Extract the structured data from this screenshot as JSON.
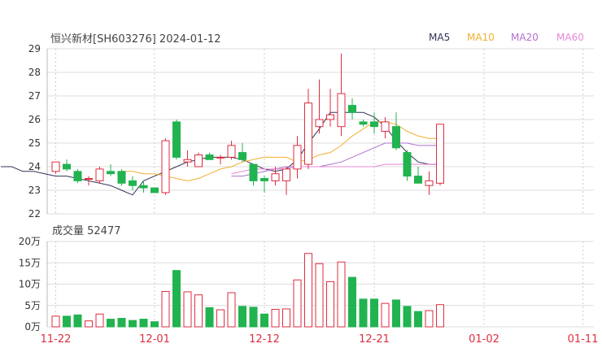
{
  "title": "恒兴新材[SH603276] 2024-01-12",
  "chart_data": [
    {
      "type": "candlestick",
      "ylim": [
        22,
        29
      ],
      "yticks": [
        22,
        23,
        24,
        25,
        26,
        27,
        28,
        29
      ],
      "x_tick_labels": [
        {
          "index": 0,
          "label": "11-22"
        },
        {
          "index": 9,
          "label": "12-01"
        },
        {
          "index": 19,
          "label": "12-12"
        },
        {
          "index": 29,
          "label": "12-21"
        },
        {
          "index": 39,
          "label": "01-02"
        },
        {
          "index": 48,
          "label": "01-11"
        }
      ],
      "legend": [
        {
          "name": "MA5",
          "color": "#333355"
        },
        {
          "name": "MA10",
          "color": "#f0b030"
        },
        {
          "name": "MA20",
          "color": "#b070d0"
        },
        {
          "name": "MA60",
          "color": "#e888d8"
        }
      ],
      "candles": [
        {
          "o": 23.8,
          "h": 24.2,
          "l": 23.7,
          "c": 24.2
        },
        {
          "o": 24.1,
          "h": 24.3,
          "l": 23.8,
          "c": 23.9
        },
        {
          "o": 23.8,
          "h": 23.9,
          "l": 23.3,
          "c": 23.4
        },
        {
          "o": 23.5,
          "h": 23.6,
          "l": 23.2,
          "c": 23.5
        },
        {
          "o": 23.4,
          "h": 24.0,
          "l": 23.3,
          "c": 23.9
        },
        {
          "o": 23.8,
          "h": 24.1,
          "l": 23.6,
          "c": 23.7
        },
        {
          "o": 23.8,
          "h": 23.9,
          "l": 23.2,
          "c": 23.3
        },
        {
          "o": 23.4,
          "h": 23.6,
          "l": 23.0,
          "c": 23.2
        },
        {
          "o": 23.2,
          "h": 23.4,
          "l": 22.9,
          "c": 23.1
        },
        {
          "o": 23.1,
          "h": 23.1,
          "l": 22.9,
          "c": 22.9
        },
        {
          "o": 22.9,
          "h": 25.2,
          "l": 22.8,
          "c": 25.1
        },
        {
          "o": 25.9,
          "h": 26.0,
          "l": 24.3,
          "c": 24.4
        },
        {
          "o": 24.2,
          "h": 24.7,
          "l": 24.0,
          "c": 24.3
        },
        {
          "o": 24.0,
          "h": 24.6,
          "l": 24.0,
          "c": 24.5
        },
        {
          "o": 24.5,
          "h": 24.6,
          "l": 24.3,
          "c": 24.3
        },
        {
          "o": 24.4,
          "h": 24.5,
          "l": 24.1,
          "c": 24.4
        },
        {
          "o": 24.4,
          "h": 25.1,
          "l": 24.3,
          "c": 24.9
        },
        {
          "o": 24.6,
          "h": 25.0,
          "l": 24.2,
          "c": 24.3
        },
        {
          "o": 24.1,
          "h": 24.1,
          "l": 23.2,
          "c": 23.4
        },
        {
          "o": 23.5,
          "h": 23.6,
          "l": 22.9,
          "c": 23.4
        },
        {
          "o": 23.4,
          "h": 24.0,
          "l": 23.2,
          "c": 23.7
        },
        {
          "o": 23.4,
          "h": 24.0,
          "l": 22.8,
          "c": 23.9
        },
        {
          "o": 23.9,
          "h": 25.3,
          "l": 23.5,
          "c": 24.9
        },
        {
          "o": 24.1,
          "h": 27.3,
          "l": 23.9,
          "c": 26.7
        },
        {
          "o": 25.7,
          "h": 27.7,
          "l": 25.4,
          "c": 26.0
        },
        {
          "o": 26.0,
          "h": 27.3,
          "l": 25.7,
          "c": 26.2
        },
        {
          "o": 25.7,
          "h": 28.8,
          "l": 25.3,
          "c": 27.1
        },
        {
          "o": 26.6,
          "h": 26.9,
          "l": 26.0,
          "c": 26.3
        },
        {
          "o": 25.9,
          "h": 26.0,
          "l": 25.7,
          "c": 25.8
        },
        {
          "o": 25.9,
          "h": 26.3,
          "l": 25.4,
          "c": 25.7
        },
        {
          "o": 25.5,
          "h": 26.1,
          "l": 25.2,
          "c": 25.9
        },
        {
          "o": 25.7,
          "h": 26.3,
          "l": 24.7,
          "c": 24.8
        },
        {
          "o": 24.6,
          "h": 24.7,
          "l": 23.4,
          "c": 23.6
        },
        {
          "o": 23.6,
          "h": 24.0,
          "l": 23.3,
          "c": 23.3
        },
        {
          "o": 23.2,
          "h": 23.8,
          "l": 22.8,
          "c": 23.4
        },
        {
          "o": 23.3,
          "h": 25.8,
          "l": 23.2,
          "c": 25.8
        }
      ],
      "ma_lines": {
        "MA5": [
          24.0,
          24.0,
          23.8,
          23.8,
          23.7,
          23.6,
          23.6,
          23.5,
          23.4,
          23.3,
          23.2,
          23.0,
          22.8,
          23.4,
          23.6,
          23.8,
          24.0,
          24.2,
          24.3,
          24.4,
          24.4,
          24.4,
          24.3,
          24.1,
          23.9,
          23.8,
          23.9,
          24.3,
          25.0,
          25.6,
          26.3,
          26.3,
          26.3,
          26.3,
          26.1,
          25.7,
          25.1,
          24.6,
          24.2,
          24.1,
          24.1
        ],
        "MA10": [
          23.8,
          23.8,
          23.7,
          23.7,
          23.6,
          23.5,
          23.4,
          23.5,
          23.7,
          23.9,
          24.0,
          24.2,
          24.3,
          24.4,
          24.4,
          24.4,
          24.2,
          24.3,
          24.5,
          24.6,
          24.9,
          25.3,
          25.6,
          25.9,
          25.9,
          25.8,
          25.5,
          25.3,
          25.2,
          25.2
        ],
        "MA20": [
          23.6,
          23.6,
          23.7,
          23.8,
          23.9,
          24.0,
          24.0,
          24.0,
          24.0,
          24.1,
          24.2,
          24.4,
          24.6,
          24.8,
          25.0,
          25.0,
          25.0,
          24.9,
          24.9,
          24.9
        ],
        "MA60": [
          23.7,
          23.8,
          23.9,
          23.9,
          23.9,
          23.9,
          24.0,
          24.0,
          24.0,
          24.0,
          24.0,
          24.0,
          24.0,
          24.0,
          24.1,
          24.1,
          24.1,
          24.1,
          24.1,
          24.1
        ]
      }
    },
    {
      "type": "bar",
      "label": "成交量 52477",
      "ylim": [
        0,
        20
      ],
      "ytick_labels": [
        "0万",
        "5万",
        "10万",
        "15万",
        "20万"
      ],
      "yticks": [
        0,
        5,
        10,
        15,
        20
      ],
      "values": [
        2.5,
        2.5,
        2.8,
        1.4,
        3.0,
        1.8,
        2.0,
        1.5,
        1.8,
        1.2,
        8.3,
        13.2,
        8.2,
        7.5,
        4.5,
        4.0,
        8.0,
        4.8,
        4.6,
        3.0,
        4.1,
        4.2,
        11.0,
        17.2,
        14.8,
        10.6,
        15.2,
        11.6,
        6.5,
        6.5,
        5.5,
        6.3,
        4.8,
        3.6,
        3.8,
        5.2
      ]
    }
  ]
}
